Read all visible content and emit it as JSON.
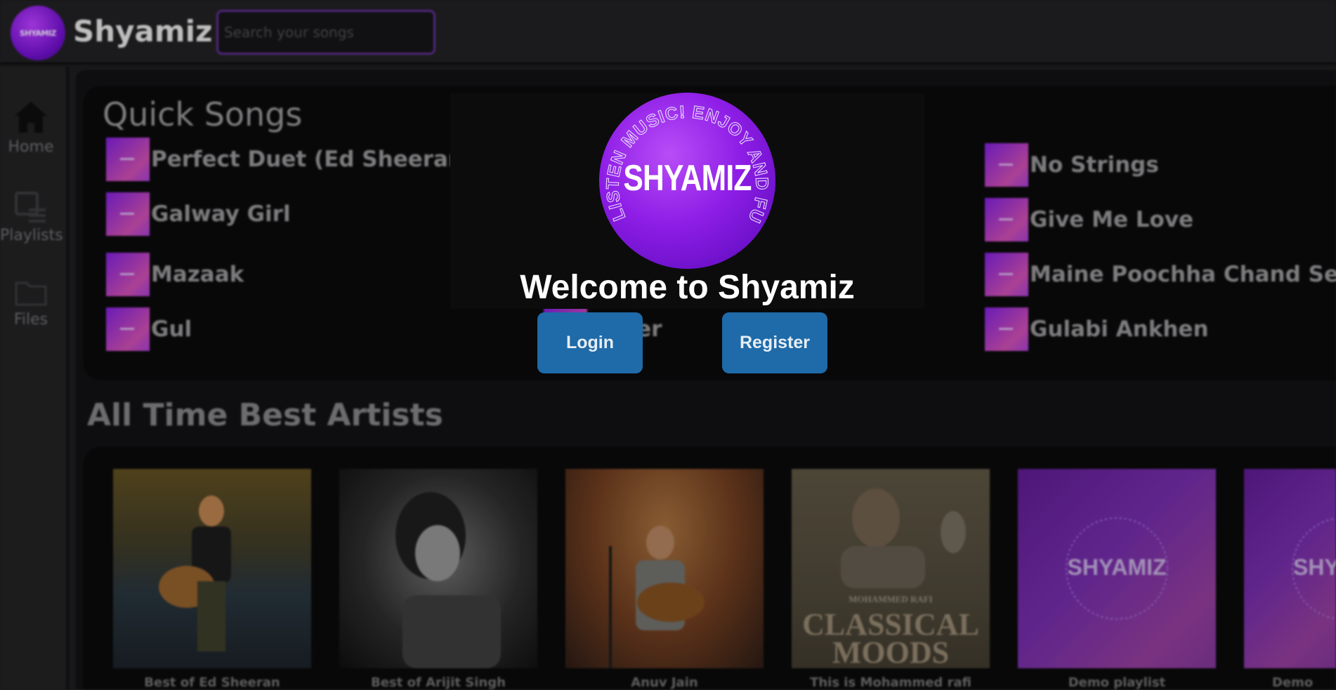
{
  "header": {
    "logo_text": "SHYAMIZ",
    "brand": "Shyamiz",
    "search_placeholder": "Search your songs"
  },
  "sidebar": {
    "items": [
      {
        "label": "Home",
        "icon": "home-icon"
      },
      {
        "label": "Playlists",
        "icon": "playlist-icon"
      },
      {
        "label": "Files",
        "icon": "folder-icon"
      }
    ]
  },
  "quick_songs": {
    "title": "Quick Songs",
    "col1": [
      "Perfect Duet (Ed Sheeran &",
      "Galway Girl",
      "Mazaak",
      "Gul"
    ],
    "col2": [
      "...pier"
    ],
    "col3": [
      "No Strings",
      "Give Me Love",
      "Maine Poochha Chand Se",
      "Gulabi Ankhen"
    ]
  },
  "artists": {
    "title": "All Time Best Artists",
    "cards": [
      {
        "name": "Best of Ed Sheeran"
      },
      {
        "name": "Best of Arijit Singh"
      },
      {
        "name": "Anuv Jain"
      },
      {
        "name": "This is Mohammed rafi",
        "label_top": "MOHAMMED RAFI",
        "label_main1": "CLASSICAL",
        "label_main2": "MOODS"
      },
      {
        "name": "Demo playlist",
        "label": "SHYAMIZ"
      },
      {
        "name": "Demo",
        "label": "SHY"
      }
    ]
  },
  "modal": {
    "logo_text": "SHYAMIZ",
    "logo_ring_text": "LISTEN MUSIC! ENJOY AND FUN",
    "welcome": "Welcome to Shyamiz",
    "login": "Login",
    "register": "Register"
  },
  "colors": {
    "accent_purple": "#8e1ee6",
    "button_blue": "#1f6aa8"
  }
}
